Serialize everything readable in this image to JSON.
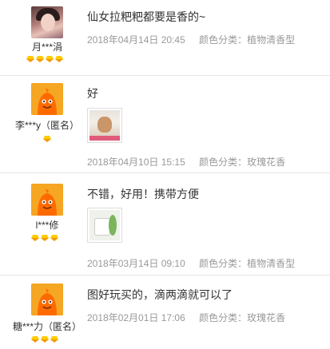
{
  "reviews": [
    {
      "username": "月***涓",
      "avatar": "photo",
      "text": "仙女拉粑粑都要是香的~",
      "date": "2018年04月14日 20:45",
      "spec": "颜色分类：植物清香型",
      "badges": 4,
      "has_image": false
    },
    {
      "username": "李***y（匿名）",
      "avatar": "mascot",
      "text": "好",
      "date": "2018年04月10日 15:15",
      "spec": "颜色分类：玫瑰花香",
      "badges": 1,
      "has_image": true,
      "image_icon": "cat-photo-thumbnail"
    },
    {
      "username": "l***修",
      "avatar": "mascot",
      "text": "不错，好用！携带方便",
      "date": "2018年03月14日 09:10",
      "spec": "颜色分类：植物清香型",
      "badges": 3,
      "has_image": true,
      "image_icon": "product-photo-thumbnail"
    },
    {
      "username": "糖***力（匿名）",
      "avatar": "mascot",
      "text": "图好玩买的，滴两滴就可以了",
      "date": "2018年02月01日 17:06",
      "spec": "颜色分类：玫瑰花香",
      "badges": 3,
      "has_image": false
    }
  ],
  "colors": {
    "text": "#333333",
    "meta": "#999999",
    "divider": "#e6e6e6",
    "badge_gold": "#ffcc00",
    "mascot_orange": "#f5a623"
  }
}
